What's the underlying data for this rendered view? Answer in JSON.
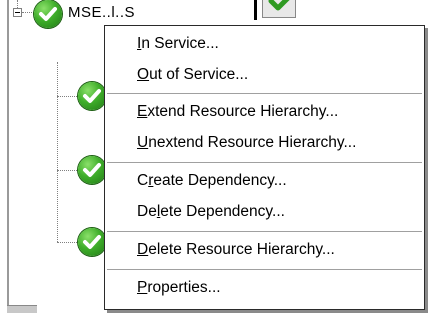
{
  "tree": {
    "root_label": "MSE..l..S",
    "nodes": [
      {
        "status": "in-service"
      },
      {
        "status": "in-service"
      },
      {
        "status": "in-service"
      },
      {
        "status": "in-service"
      }
    ]
  },
  "context_menu": {
    "items": [
      {
        "pre": "",
        "accel": "I",
        "post": "n Service..."
      },
      {
        "pre": "",
        "accel": "O",
        "post": "ut of Service..."
      },
      {
        "pre": "",
        "accel": "E",
        "post": "xtend Resource Hierarchy..."
      },
      {
        "pre": "",
        "accel": "U",
        "post": "nextend Resource Hierarchy..."
      },
      {
        "pre": "C",
        "accel": "r",
        "post": "eate Dependency..."
      },
      {
        "pre": "De",
        "accel": "l",
        "post": "ete Dependency..."
      },
      {
        "pre": "",
        "accel": "D",
        "post": "elete Resource Hierarchy..."
      },
      {
        "pre": "",
        "accel": "P",
        "post": "roperties..."
      }
    ]
  },
  "icons": {
    "status_ok": "green-checkmark-icon",
    "expander": "tree-collapse-icon"
  },
  "colors": {
    "check_green": "#3fae2a",
    "menu_border": "#2a2a2a",
    "separator": "#a0a0a0"
  }
}
